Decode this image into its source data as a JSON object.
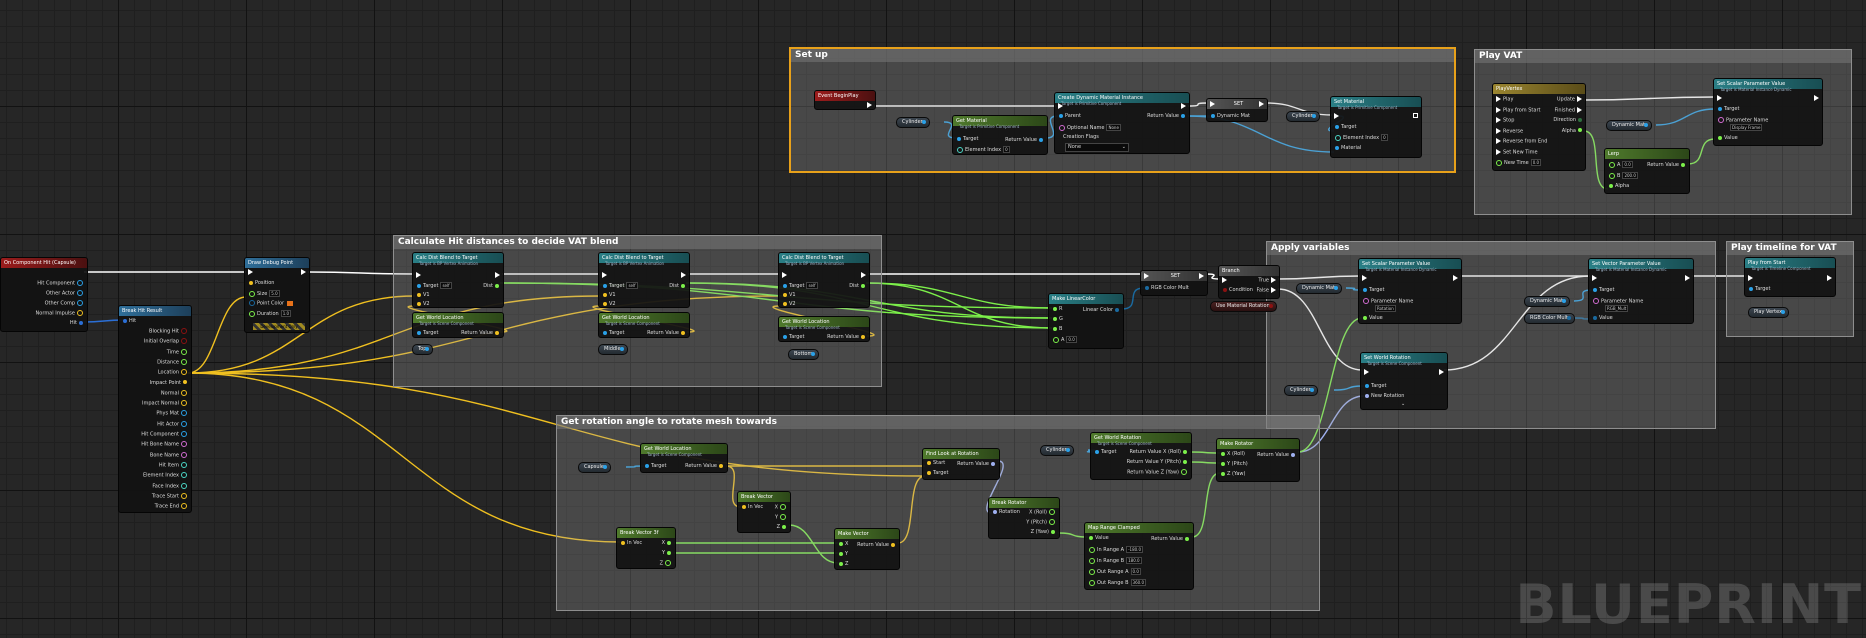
{
  "colors": {
    "exec": "#ffffff",
    "object": "#2aa1e8",
    "vector": "#f0c020",
    "float": "#7cf04a",
    "bool": "#8b1111",
    "struct": "#2b6fd6",
    "rotator": "#9fb0f0",
    "linear_color": "#1a6aa0",
    "selection": "#e8a11a"
  },
  "comments": {
    "setup": "Set up",
    "play_vat": "Play VAT",
    "calc": "Calculate Hit distances to decide VAT blend",
    "apply": "Apply variables",
    "play_timeline": "Play timeline for VAT",
    "rotation": "Get rotation angle to rotate mesh towards"
  },
  "watermark": "BLUEPRINT",
  "on_hit": {
    "title": "On Component Hit (Capsule)",
    "pins": [
      "Hit Component",
      "Other Actor",
      "Other Comp",
      "Normal Impulse",
      "Hit"
    ]
  },
  "break_hit": {
    "title": "Break Hit Result",
    "in": "Hit",
    "pins": [
      "Blocking Hit",
      "Initial Overlap",
      "Time",
      "Distance",
      "Location",
      "Impact Point",
      "Normal",
      "Impact Normal",
      "Phys Mat",
      "Hit Actor",
      "Hit Component",
      "Hit Bone Name",
      "Bone Name",
      "Hit Item",
      "Element Index",
      "Face Index",
      "Trace Start",
      "Trace End"
    ]
  },
  "draw_debug": {
    "title": "Draw Debug Point",
    "pins": [
      "Position",
      "Size",
      "Point Color",
      "Duration"
    ],
    "size": "5.0",
    "duration": "1.0",
    "footer": "Development Only"
  },
  "calc_blend": [
    {
      "title": "Calc Dist Blend to Target",
      "sub": "Target is BP Vertex Animation",
      "target": "self",
      "pins": [
        "Target",
        "V1",
        "V2"
      ],
      "out": "Dist"
    },
    {
      "title": "Calc Dist Blend to Target",
      "sub": "Target is BP Vertex Animation",
      "target": "self",
      "pins": [
        "Target",
        "V1",
        "V2"
      ],
      "out": "Dist"
    },
    {
      "title": "Calc Dist Blend to Target",
      "sub": "Target is BP Vertex Animation",
      "target": "self",
      "pins": [
        "Target",
        "V1",
        "V2"
      ],
      "out": "Dist"
    }
  ],
  "world_loc": {
    "title": "Get World Location",
    "sub": "Target is Scene Component",
    "target": "Target",
    "ret": "Return Value"
  },
  "loc_vars": [
    "Top",
    "Middle",
    "Bottom"
  ],
  "make_color": {
    "title": "Make LinearColor",
    "pins": [
      "R",
      "G",
      "B",
      "A"
    ],
    "a": "0.0",
    "out": "Linear Color"
  },
  "set_rgb": {
    "title": "SET",
    "pin": "RGB Color Mult"
  },
  "branch": {
    "title": "Branch",
    "cond": "Condition",
    "true": "True",
    "false": "False"
  },
  "use_mat_rot": "Use Material Rotation",
  "setup_nodes": {
    "begin_play": "Event BeginPlay",
    "cylinder": "Cylinder",
    "get_material": {
      "title": "Get Material",
      "sub": "Target is Primitive Component",
      "target": "Target",
      "elem": "Element Index",
      "elem_val": "0",
      "ret": "Return Value"
    },
    "create_dmi": {
      "title": "Create Dynamic Material Instance",
      "sub": "Target is Primitive Component",
      "parent": "Parent",
      "opt": "Optional Name",
      "opt_val": "None",
      "flags": "Creation Flags",
      "flags_val": "None",
      "ret": "Return Value"
    },
    "set_dm": {
      "title": "SET",
      "pin": "Dynamic Mat"
    },
    "set_material": {
      "title": "Set Material",
      "sub": "Target is Primitive Component",
      "target": "Target",
      "elem": "Element Index",
      "elem_val": "0",
      "mat": "Material"
    }
  },
  "play_vat_nodes": {
    "timeline": {
      "title": "PlayVertex",
      "in": [
        "Play",
        "Play from Start",
        "Stop",
        "Reverse",
        "Reverse from End",
        "Set New Time",
        "New Time"
      ],
      "new_time": "0.0",
      "out": [
        "Update",
        "Finished",
        "Direction",
        "Alpha"
      ]
    },
    "dyn_mat": "Dynamic Mat",
    "set_scalar": {
      "title": "Set Scalar Parameter Value",
      "sub": "Target is Material Instance Dynamic",
      "target": "Target",
      "param": "Parameter Name",
      "param_val": "Display Frame",
      "value": "Value"
    },
    "lerp": {
      "title": "Lerp",
      "a": "A",
      "a_val": "0.0",
      "b": "B",
      "b_val": "200.0",
      "alpha": "Alpha",
      "ret": "Return Value"
    }
  },
  "apply_nodes": {
    "dyn_mat": "Dynamic Mat",
    "set_scalar": {
      "title": "Set Scalar Parameter Value",
      "sub": "Target is Material Instance Dynamic",
      "target": "Target",
      "param": "Parameter Name",
      "param_val": "Rotation",
      "value": "Value"
    },
    "set_vector": {
      "title": "Set Vector Parameter Value",
      "sub": "Target is Material Instance Dynamic",
      "target": "Target",
      "param": "Parameter Name",
      "param_val": "RGB_Mult",
      "value": "Value"
    },
    "rgb_mult": "RGB Color Mult",
    "cylinder": "Cylinder",
    "set_world_rot": {
      "title": "Set World Rotation",
      "sub": "Target is Scene Component",
      "target": "Target",
      "new_rot": "New Rotation"
    }
  },
  "timeline_nodes": {
    "play_from_start": {
      "title": "Play from Start",
      "sub": "Target is Timeline Component",
      "target": "Target"
    },
    "var": "Play Vertex"
  },
  "rotation_nodes": {
    "capsule": "Capsule",
    "world_loc": {
      "title": "Get World Location",
      "sub": "Target is Scene Component",
      "target": "Target",
      "ret": "Return Value"
    },
    "break_vec_a": {
      "title": "Break Vector",
      "in": "In Vec",
      "out": [
        "X",
        "Y",
        "Z"
      ]
    },
    "break_vec_b": {
      "title": "Break Vector 3f",
      "in": "In Vec",
      "out": [
        "X",
        "Y",
        "Z"
      ]
    },
    "make_vec": {
      "title": "Make Vector",
      "in": [
        "X",
        "Y",
        "Z"
      ],
      "ret": "Return Value"
    },
    "find_look": {
      "title": "Find Look at Rotation",
      "in": [
        "Start",
        "Target"
      ],
      "ret": "Return Value"
    },
    "break_rot": {
      "title": "Break Rotator",
      "in": "Rotation",
      "out": [
        "X (Roll)",
        "Y (Pitch)",
        "Z (Yaw)"
      ]
    },
    "cylinder": "Cylinder",
    "get_world_rot": {
      "title": "Get World Rotation",
      "sub": "Target is Scene Component",
      "target": "Target",
      "out": [
        "Return Value X (Roll)",
        "Return Value Y (Pitch)",
        "Return Value Z (Yaw)"
      ]
    },
    "map_range": {
      "title": "Map Range Clamped",
      "pins": [
        "Value",
        "In Range A",
        "In Range B",
        "Out Range A",
        "Out Range B"
      ],
      "vals": [
        "-180.0",
        "180.0",
        "0.0",
        "360.0"
      ],
      "ret": "Return Value"
    },
    "make_rot": {
      "title": "Make Rotator",
      "in": [
        "X (Roll)",
        "Y (Pitch)",
        "Z (Yaw)"
      ],
      "ret": "Return Value"
    }
  }
}
